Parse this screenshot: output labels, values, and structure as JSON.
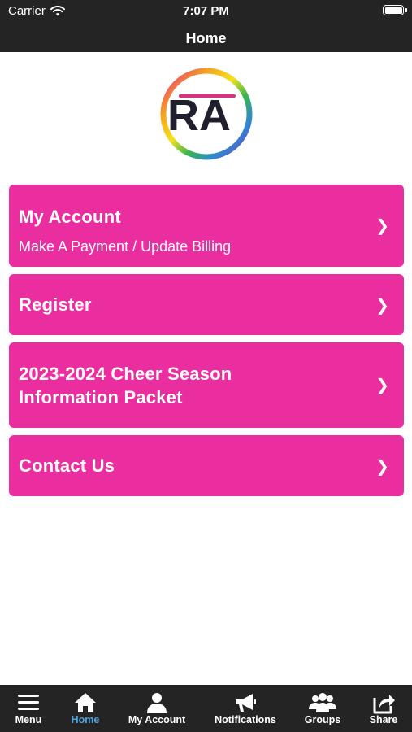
{
  "status_bar": {
    "carrier": "Carrier",
    "time": "7:07 PM"
  },
  "nav": {
    "title": "Home"
  },
  "logo": {
    "text": "RA"
  },
  "menu": [
    {
      "title": "My Account",
      "subtitle": "Make A Payment / Update Billing",
      "chevron": "❯"
    },
    {
      "title": "Register",
      "chevron": "❯"
    },
    {
      "title_line1": "2023-2024 Cheer Season",
      "title_line2": "Information Packet",
      "chevron": "❯"
    },
    {
      "title": "Contact Us",
      "chevron": "❯"
    }
  ],
  "tabs": [
    {
      "label": "Menu",
      "icon": "hamburger-icon"
    },
    {
      "label": "Home",
      "icon": "home-icon",
      "active": true
    },
    {
      "label": "My Account",
      "icon": "user-icon"
    },
    {
      "label": "Notifications",
      "icon": "megaphone-icon"
    },
    {
      "label": "Groups",
      "icon": "groups-icon"
    },
    {
      "label": "Share",
      "icon": "share-icon"
    }
  ],
  "colors": {
    "card_bg": "#ea2ea0",
    "bar_bg": "#242424",
    "active_tab": "#4fa3e0",
    "logo_letters": "#1f1f2e",
    "logo_accent": "#d63384"
  }
}
